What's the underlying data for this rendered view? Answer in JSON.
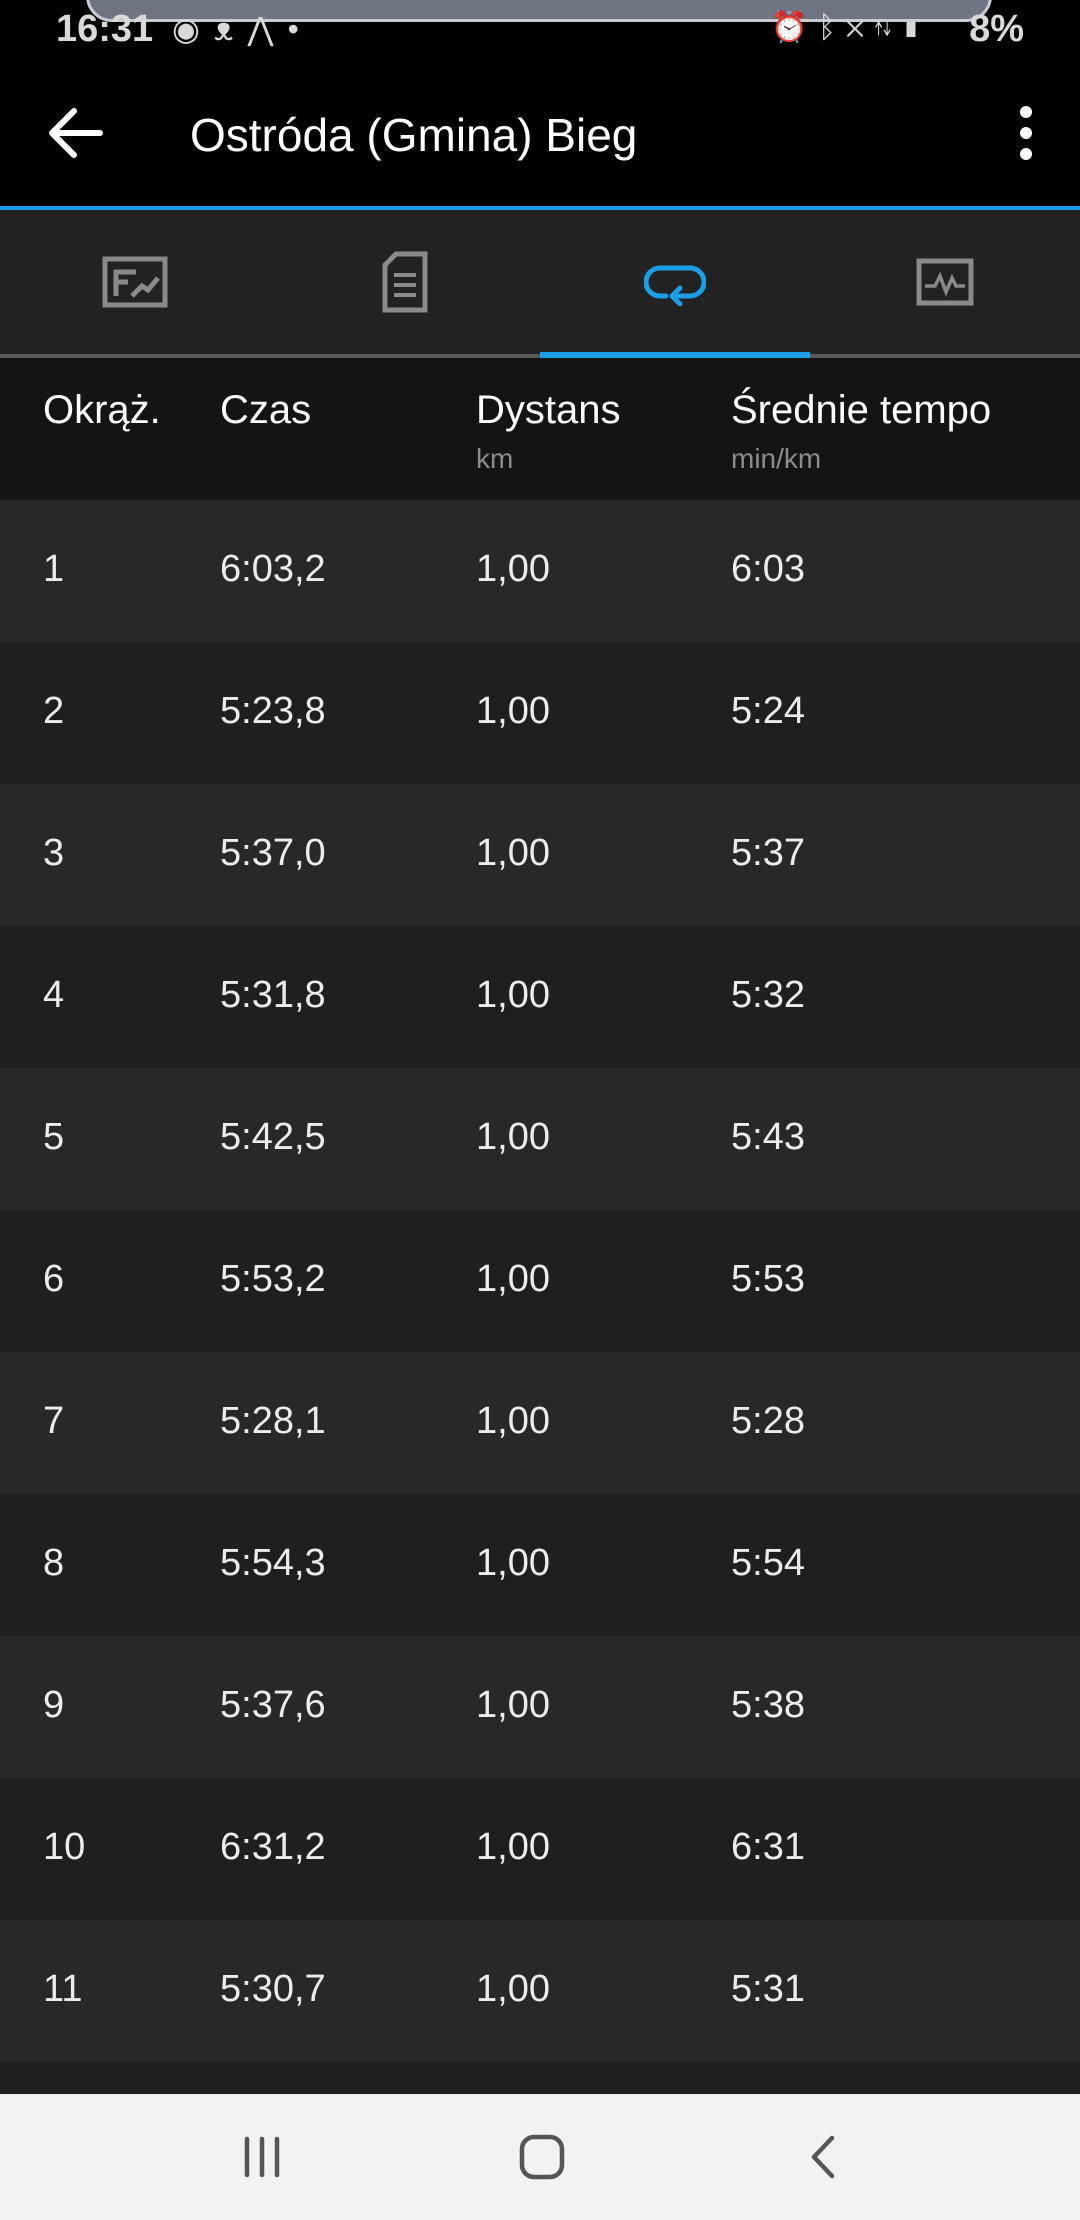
{
  "status_bar": {
    "time": "16:31",
    "left_icons": [
      "messenger-icon",
      "bird-icon",
      "strava-icon",
      "dot-icon"
    ],
    "right_icons": [
      "alarm-icon",
      "bluetooth-icon",
      "mute-icon",
      "lte-icon",
      "signal-icon"
    ],
    "battery": "8%"
  },
  "app_bar": {
    "title": "Ostróda (Gmina) Bieg",
    "back_icon": "arrow-back-icon",
    "menu_icon": "more-vert-icon",
    "accent": "#1a9ee6"
  },
  "tabs": [
    {
      "icon": "map-icon",
      "active": false
    },
    {
      "icon": "details-list-icon",
      "active": false
    },
    {
      "icon": "laps-loop-icon",
      "active": true
    },
    {
      "icon": "chart-icon",
      "active": false
    }
  ],
  "table": {
    "headers": [
      {
        "label": "Okrąż.",
        "unit": ""
      },
      {
        "label": "Czas",
        "unit": ""
      },
      {
        "label": "Dystans",
        "unit": "km"
      },
      {
        "label": "Średnie tempo",
        "unit": "min/km"
      }
    ],
    "rows": [
      [
        "1",
        "6:03,2",
        "1,00",
        "6:03"
      ],
      [
        "2",
        "5:23,8",
        "1,00",
        "5:24"
      ],
      [
        "3",
        "5:37,0",
        "1,00",
        "5:37"
      ],
      [
        "4",
        "5:31,8",
        "1,00",
        "5:32"
      ],
      [
        "5",
        "5:42,5",
        "1,00",
        "5:43"
      ],
      [
        "6",
        "5:53,2",
        "1,00",
        "5:53"
      ],
      [
        "7",
        "5:28,1",
        "1,00",
        "5:28"
      ],
      [
        "8",
        "5:54,3",
        "1,00",
        "5:54"
      ],
      [
        "9",
        "5:37,6",
        "1,00",
        "5:38"
      ],
      [
        "10",
        "6:31,2",
        "1,00",
        "6:31"
      ],
      [
        "11",
        "5:30,7",
        "1,00",
        "5:31"
      ]
    ]
  },
  "nav_bar": {
    "buttons": [
      "recents-icon",
      "home-icon",
      "back-icon"
    ]
  }
}
